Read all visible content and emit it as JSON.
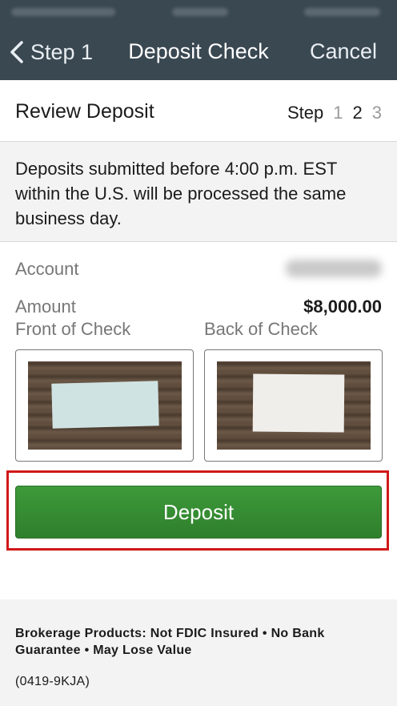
{
  "nav": {
    "back_label": "Step 1",
    "title": "Deposit Check",
    "cancel_label": "Cancel"
  },
  "header": {
    "title": "Review Deposit",
    "step_label": "Step",
    "steps": [
      "1",
      "2",
      "3"
    ],
    "current_step": "2"
  },
  "notice": {
    "text": "Deposits submitted before 4:00 p.m. EST within the U.S. will be processed the same business day."
  },
  "details": {
    "account_label": "Account",
    "amount_label": "Amount",
    "amount_value": "$8,000.00",
    "front_label": "Front of Check",
    "back_label": "Back of Check"
  },
  "actions": {
    "deposit_label": "Deposit"
  },
  "footer": {
    "disclaimer": "Brokerage Products: Not FDIC Insured • No Bank Guarantee • May Lose Value",
    "code": "(0419-9KJA)"
  },
  "colors": {
    "nav_bg": "#3a4852",
    "deposit_green": "#358c32",
    "highlight_red": "#d01818"
  }
}
